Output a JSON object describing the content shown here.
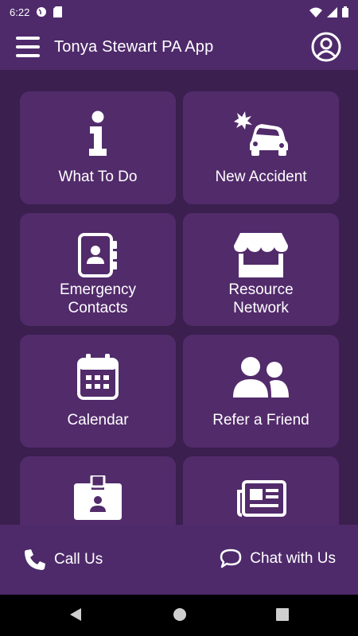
{
  "status_bar": {
    "time": "6:22"
  },
  "app_bar": {
    "title": "Tonya Stewart PA App"
  },
  "tiles": [
    {
      "label": "What To Do"
    },
    {
      "label": "New Accident"
    },
    {
      "label": "Emergency\nContacts"
    },
    {
      "label": "Resource\nNetwork"
    },
    {
      "label": "Calendar"
    },
    {
      "label": "Refer a Friend"
    }
  ],
  "bottom_bar": {
    "call_label": "Call Us",
    "chat_label": "Chat with Us"
  },
  "colors": {
    "header": "#4e2a6b",
    "background": "#3a1f4f",
    "tile": "#522b6b"
  },
  "icons": [
    "menu-icon",
    "profile-icon",
    "info-icon",
    "car-crash-icon",
    "contacts-book-icon",
    "store-icon",
    "calendar-icon",
    "users-icon",
    "id-badge-icon",
    "newspaper-icon",
    "phone-icon",
    "chat-bubble-icon"
  ]
}
